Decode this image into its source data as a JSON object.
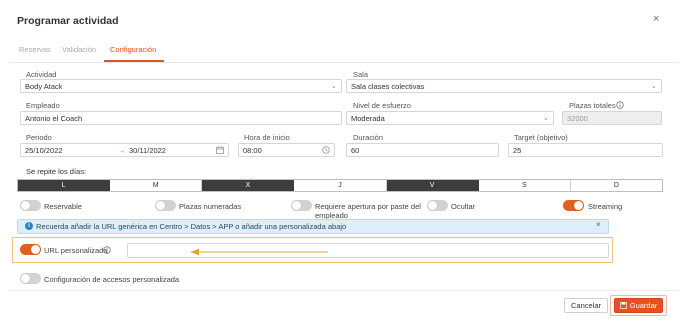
{
  "dialog": {
    "title": "Programar actividad",
    "close_symbol": "×"
  },
  "tabs": [
    {
      "label": "Reservas",
      "active": false
    },
    {
      "label": "Validación",
      "active": false
    },
    {
      "label": "Configuración",
      "active": true
    }
  ],
  "form": {
    "actividad": {
      "label": "Actividad",
      "value": "Body Atack"
    },
    "sala": {
      "label": "Sala",
      "value": "Sala clases colectivas"
    },
    "empleado": {
      "label": "Empleado",
      "value": "Antonio el Coach"
    },
    "nivel": {
      "label": "Nivel de esfuerzo",
      "value": "Moderada"
    },
    "plazas": {
      "label": "Plazas totales",
      "value": "32000"
    },
    "periodo": {
      "label": "Periodo",
      "start": "25/10/2022",
      "arrow": "→",
      "end": "30/11/2022"
    },
    "hora": {
      "label": "Hora de inicio",
      "value": "08:00"
    },
    "duracion": {
      "label": "Duración",
      "value": "60"
    },
    "target": {
      "label": "Target (objetivo)",
      "value": "25"
    }
  },
  "days": {
    "label": "Se repite los días:",
    "items": [
      {
        "label": "L",
        "selected": true
      },
      {
        "label": "M",
        "selected": false
      },
      {
        "label": "X",
        "selected": true
      },
      {
        "label": "J",
        "selected": false
      },
      {
        "label": "V",
        "selected": true
      },
      {
        "label": "S",
        "selected": false
      },
      {
        "label": "D",
        "selected": false
      }
    ]
  },
  "toggles": {
    "reservable": {
      "label": "Reservable",
      "on": false
    },
    "plazas_numeradas": {
      "label": "Plazas numeradas",
      "on": false
    },
    "apertura": {
      "label_line1": "Requiere apertura por paste del",
      "label_line2": "empleado",
      "on": false
    },
    "ocultar": {
      "label": "Ocultar",
      "on": false
    },
    "streaming": {
      "label": "Streaming",
      "on": true
    },
    "url_personalizada": {
      "label": "URL personalizada",
      "on": true
    },
    "config_accesos": {
      "label": "Configuración de accesos personalizada",
      "on": false
    }
  },
  "banner": {
    "icon_letter": "i",
    "text": "Recuerda añadir la URL genérica en Centro > Datos > APP o añadir una personalizada abajo",
    "close_symbol": "×"
  },
  "url_input": {
    "value": ""
  },
  "buttons": {
    "cancel": "Cancelar",
    "save": "Guardar"
  },
  "colors": {
    "accent": "#e8501e",
    "highlight_border": "#e7c577",
    "arrow": "#d9a82a",
    "banner_bg": "#dbeefa"
  }
}
